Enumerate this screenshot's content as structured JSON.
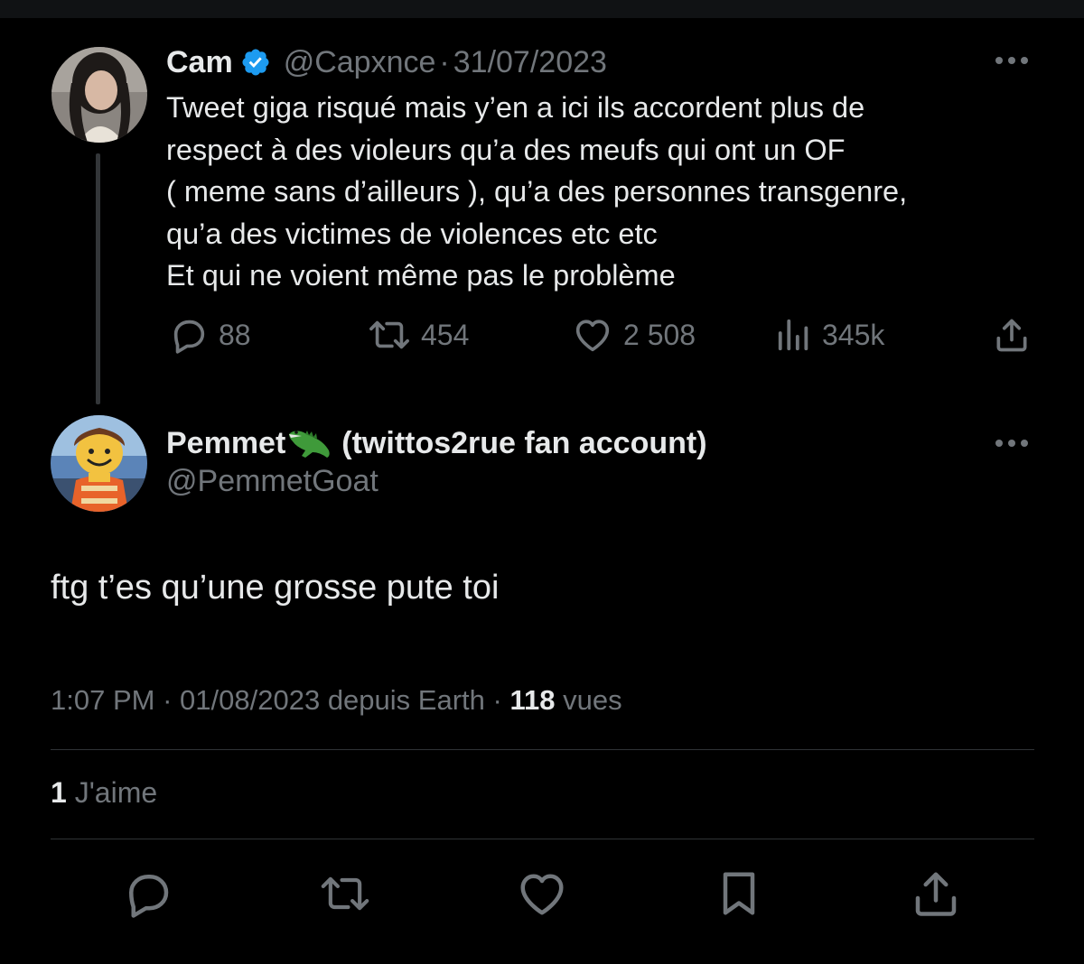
{
  "colors": {
    "background": "#000000",
    "primary_text": "#e7e9ea",
    "secondary_text": "#71767b",
    "verified_badge": "#1d9bf0",
    "divider": "#2f3336"
  },
  "parent_tweet": {
    "display_name": "Cam",
    "verified_icon": "verified-badge-icon",
    "handle": "@Capxnce",
    "separator": "·",
    "date": "31/07/2023",
    "text_lines": [
      "Tweet giga risqué mais y’en a ici ils accordent plus de",
      "respect à des violeurs qu’a des meufs qui ont un OF",
      "( meme sans d’ailleurs ), qu’a des personnes transgenre,",
      "qu’a des victimes de violences etc etc",
      "Et qui ne voient même pas le problème"
    ],
    "actions": {
      "replies": "88",
      "retweets": "454",
      "likes": "2 508",
      "views": "345k"
    }
  },
  "reply_tweet": {
    "display_name": "Pemmet",
    "name_emoji": "crocodile-emoji",
    "name_suffix": "(twittos2rue fan account)",
    "handle": "@PemmetGoat",
    "text": "ftg t’es qu’une grosse pute toi",
    "meta": {
      "time": "1:07 PM",
      "date": "01/08/2023",
      "source": "depuis Earth",
      "view_count": "118",
      "view_label": "vues"
    },
    "likes": {
      "count": "1",
      "label": "J'aime"
    }
  },
  "action_bar": [
    "reply-icon",
    "retweet-icon",
    "like-icon",
    "bookmark-icon",
    "share-icon"
  ]
}
